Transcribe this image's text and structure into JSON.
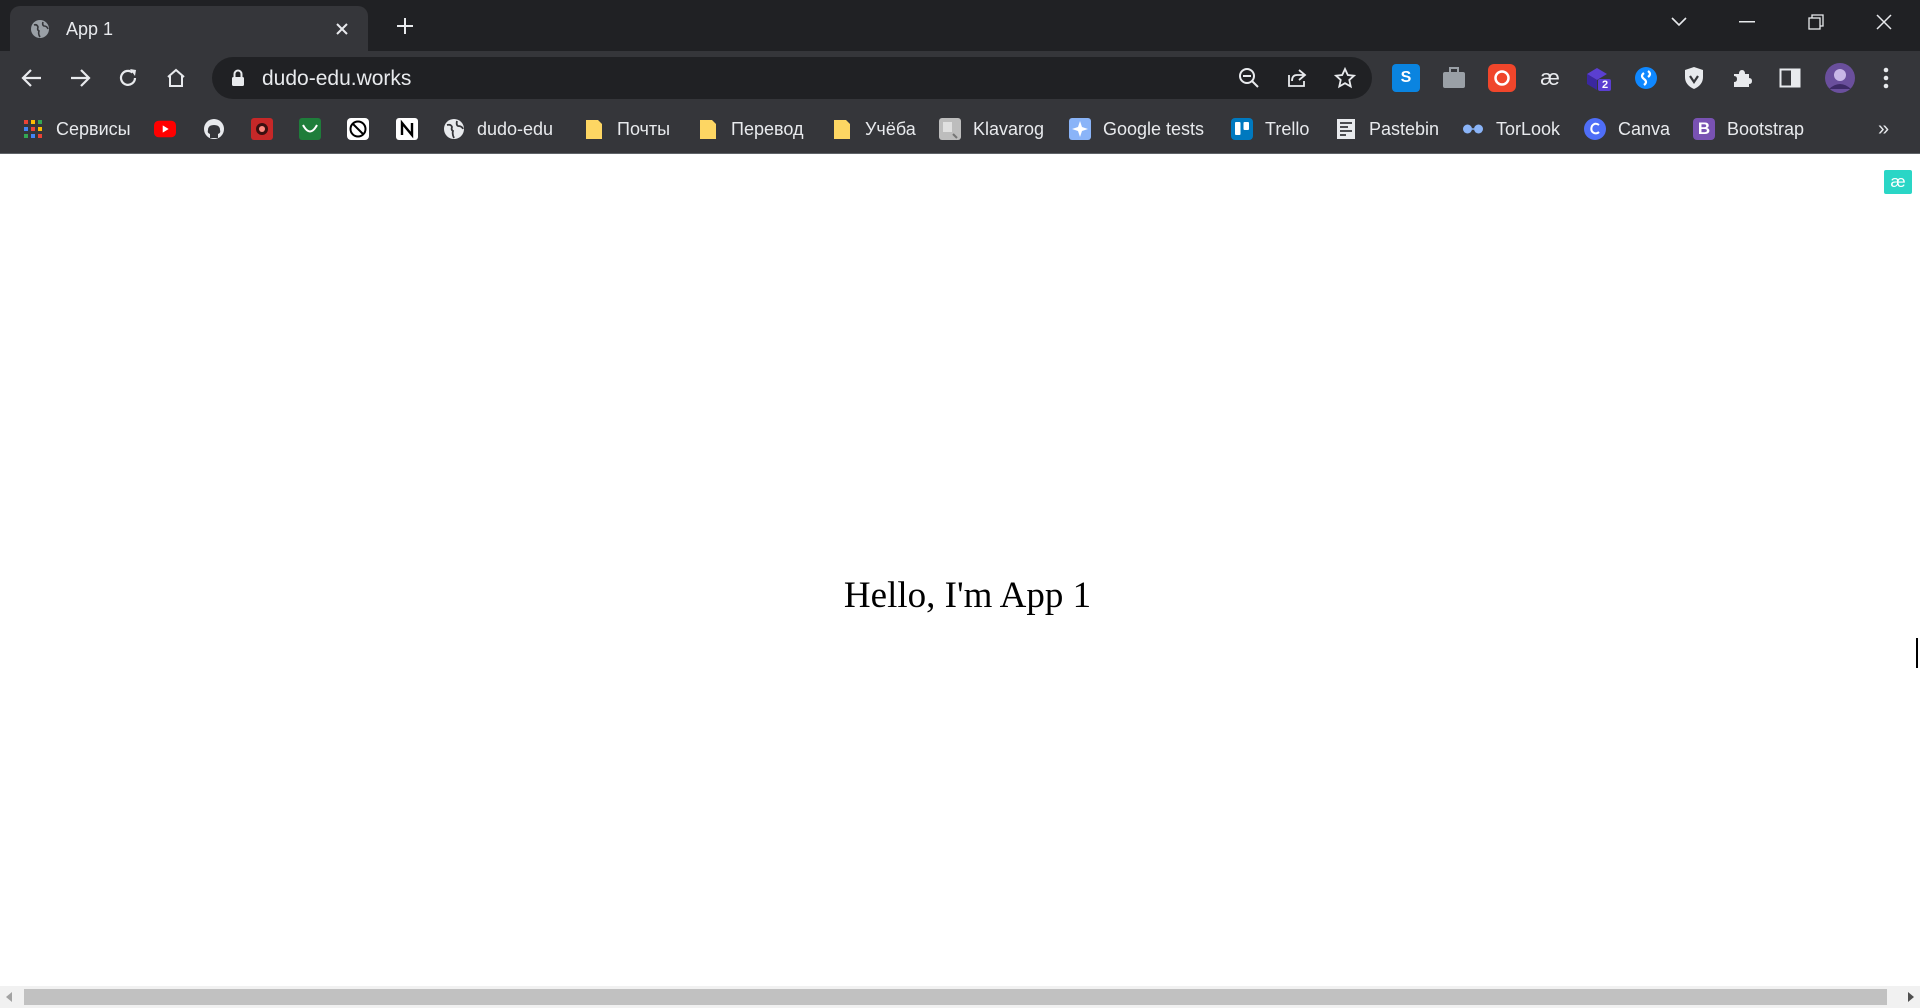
{
  "tab": {
    "title": "App 1",
    "favicon": "globe-icon"
  },
  "toolbar": {
    "url": "dudo-edu.works",
    "extensions": {
      "skype_label": "S",
      "purple_badge": "2",
      "bootstrap_letter": "B",
      "ae_label": "æ"
    }
  },
  "bookmarks": [
    {
      "label": "Сервисы",
      "icon": "apps-grid-icon"
    },
    {
      "label": "",
      "icon": "youtube-icon"
    },
    {
      "label": "",
      "icon": "github-icon"
    },
    {
      "label": "",
      "icon": "red-app-icon"
    },
    {
      "label": "",
      "icon": "green-app-icon"
    },
    {
      "label": "",
      "icon": "circle-slash-icon"
    },
    {
      "label": "",
      "icon": "notion-icon"
    },
    {
      "label": "dudo-edu",
      "icon": "globe-icon"
    },
    {
      "label": "Почты",
      "icon": "folder-icon"
    },
    {
      "label": "Перевод",
      "icon": "folder-icon"
    },
    {
      "label": "Учёба",
      "icon": "folder-icon"
    },
    {
      "label": "Klavarog",
      "icon": "keyboard-icon"
    },
    {
      "label": "Google tests",
      "icon": "google-tests-icon"
    },
    {
      "label": "Trello",
      "icon": "trello-icon"
    },
    {
      "label": "Pastebin",
      "icon": "pastebin-icon"
    },
    {
      "label": "TorLook",
      "icon": "glasses-icon"
    },
    {
      "label": "Canva",
      "icon": "canva-icon"
    },
    {
      "label": "Bootstrap",
      "icon": "bootstrap-icon"
    }
  ],
  "bookmarks_overflow": "»",
  "page": {
    "heading": "Hello, I'm App 1",
    "corner_badge": "æ"
  },
  "colors": {
    "tabstrip": "#202124",
    "toolbar": "#35363a",
    "text": "#e8eaed",
    "page_bg": "#ffffff"
  }
}
